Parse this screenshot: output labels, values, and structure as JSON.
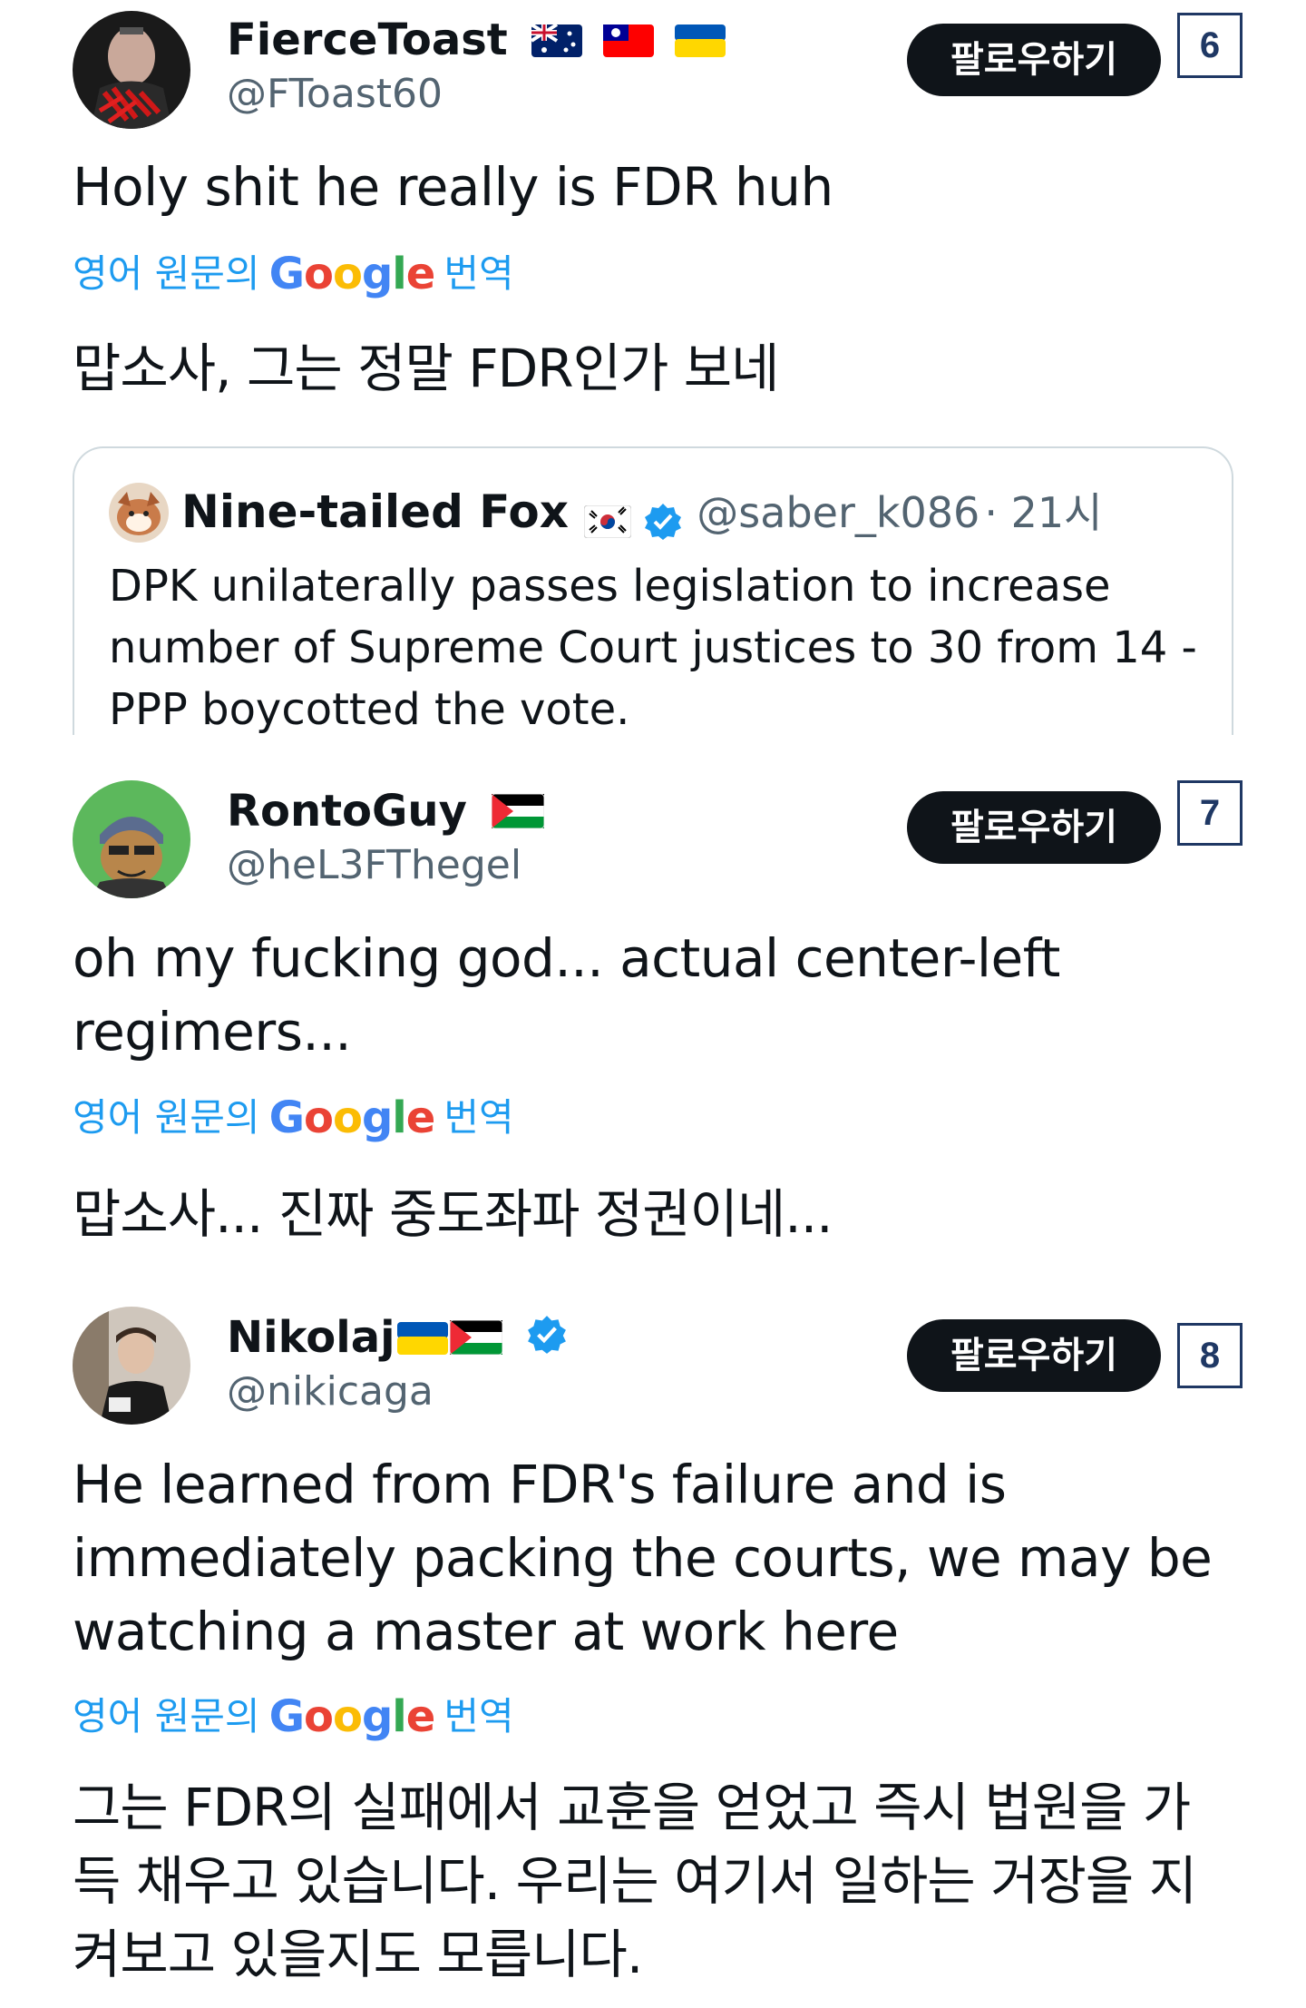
{
  "follow_label": "팔로우하기",
  "translate": {
    "prefix": "영어 원문의",
    "google": [
      "G",
      "o",
      "o",
      "g",
      "l",
      "e"
    ],
    "suffix": "번역"
  },
  "tweets": [
    {
      "number": "6",
      "name": "FierceToast",
      "flags": [
        "australia-flag",
        "taiwan-flag",
        "ukraine-flag"
      ],
      "handle": "@FToast60",
      "text": "Holy shit he really is FDR huh",
      "translation": "맙소사, 그는 정말 FDR인가 보네",
      "quote": {
        "name": "Nine-tailed Fox",
        "flag": "south-korea-flag",
        "verified": true,
        "handle": "@saber_k086",
        "time": "· 21시",
        "text": "DPK unilaterally passes legislation to increase number of Supreme Court justices to 30 from 14 - PPP boycotted the vote."
      }
    },
    {
      "number": "7",
      "name": "RontoGuy",
      "flags": [
        "palestine-flag"
      ],
      "handle": "@heL3FThegel",
      "text": "oh my fucking god... actual center-left regimers...",
      "translation": "맙소사... 진짜 중도좌파 정권이네..."
    },
    {
      "number": "8",
      "name": "Nikolaj",
      "flags": [
        "ukraine-flag",
        "palestine-flag"
      ],
      "verified": true,
      "handle": "@nikicaga",
      "text": "He learned from FDR's failure and is immediately packing the courts, we may be watching a master at work here",
      "translation": "그는 FDR의 실패에서 교훈을 얻었고 즉시 법원을 가득 채우고 있습니다. 우리는 여기서 일하는 거장을 지켜보고 있을지도 모릅니다."
    }
  ],
  "colors": {
    "text": "#0f1419",
    "secondary": "#536471",
    "link": "#1d9bf0",
    "button_bg": "#0f1419",
    "verified": "#1d9bf0",
    "number_box": "#1f3864"
  }
}
